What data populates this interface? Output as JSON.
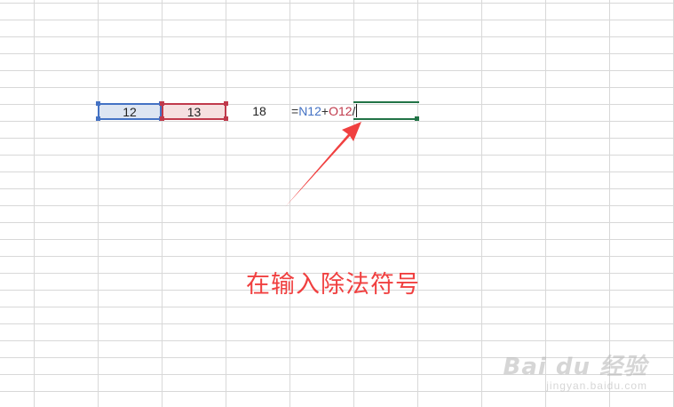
{
  "cells": {
    "n12_value": "12",
    "o12_value": "13",
    "p12_value": "18"
  },
  "formula": {
    "eq": "=",
    "ref1": "N12",
    "plus": "+",
    "ref2": "O12",
    "div": "/"
  },
  "annotation": {
    "text": "在输入除法符号",
    "color": "#f04040"
  },
  "colors": {
    "ref_blue": "#4472c4",
    "ref_red": "#c0394b",
    "active_green": "#217346",
    "grid": "#d8d8d8"
  },
  "watermark": {
    "logo": "Bai du 经验",
    "sub": "jingyan.baidu.com"
  }
}
